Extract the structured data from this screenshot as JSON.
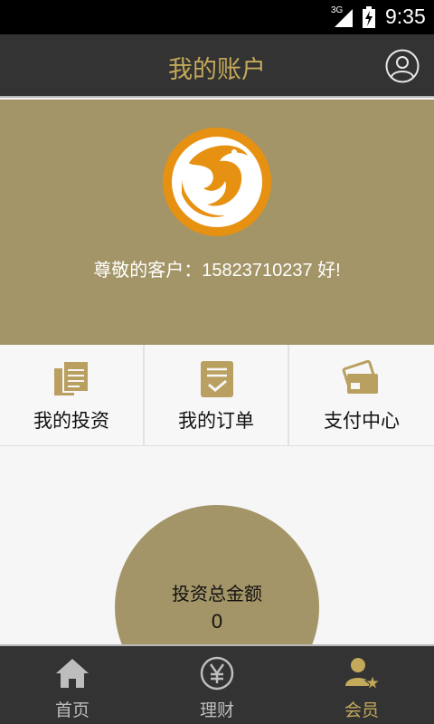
{
  "status_bar": {
    "network": "3G",
    "time": "9:35"
  },
  "header": {
    "title": "我的账户",
    "user_icon": "user-circle-icon"
  },
  "banner": {
    "greeting": "尊敬的客户：15823710237 好!",
    "logo_icon": "dragon-logo-icon"
  },
  "quick_menu": [
    {
      "label": "我的投资",
      "icon": "documents-icon"
    },
    {
      "label": "我的订单",
      "icon": "checklist-icon"
    },
    {
      "label": "支付中心",
      "icon": "card-icon"
    }
  ],
  "summary": {
    "label": "投资总金额",
    "value": "0"
  },
  "bottom_nav": [
    {
      "label": "首页",
      "icon": "home-icon",
      "active": false
    },
    {
      "label": "理财",
      "icon": "yen-icon",
      "active": false
    },
    {
      "label": "会员",
      "icon": "member-icon",
      "active": true
    }
  ],
  "colors": {
    "accent": "#c4a95a",
    "banner": "#a39567",
    "bar": "#333333"
  }
}
